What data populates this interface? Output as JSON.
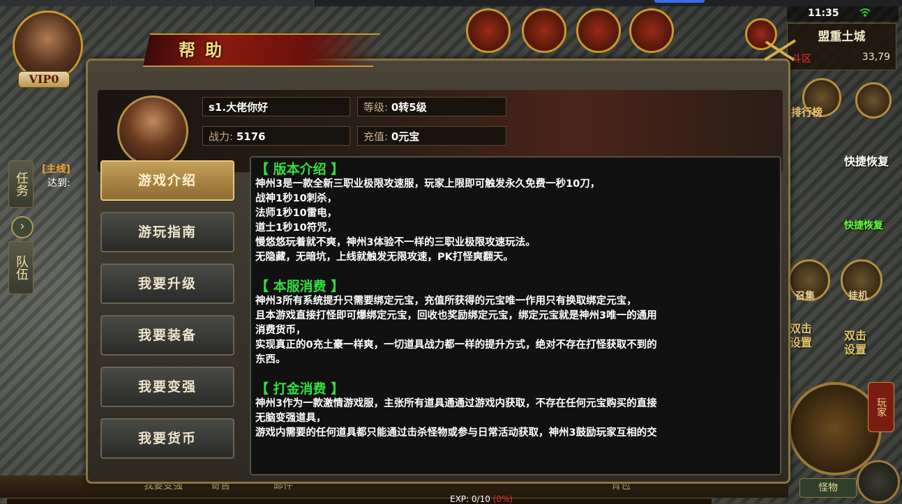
{
  "hud": {
    "clock": "11:35",
    "map_name": "盟重土城",
    "map_zone": "斗区",
    "map_coords": "33,79",
    "vip_badge": "VIP0",
    "quest_tab": "任务",
    "quest_type": "[主线]",
    "quest_goal": "达到:",
    "team_tab": "队伍",
    "ranking_label": "排行榜",
    "quick_restore": "快捷恢复",
    "quick_restore_2": "快捷恢复",
    "summon_label": "召集",
    "autohunt_label": "挂机",
    "double_click_left": "双击设置",
    "double_click_right": "双击设置",
    "play_tab": "玩家",
    "monster_button": "怪物",
    "bottom_items": [
      "我要变强",
      "寄售",
      "邮件",
      "背包"
    ],
    "exp_label": "EXP: 0/10",
    "exp_pct": "(0%)",
    "exp_fraction": 0
  },
  "dialog": {
    "title": "帮助",
    "player": {
      "name": "s1.大佬你好",
      "level_label": "等级:",
      "level_value": "0转5级",
      "power_label": "战力:",
      "power_value": "5176",
      "recharge_label": "充值:",
      "recharge_value": "0元宝"
    },
    "menu": [
      {
        "label": "游戏介绍",
        "active": true
      },
      {
        "label": "游玩指南",
        "active": false
      },
      {
        "label": "我要升级",
        "active": false
      },
      {
        "label": "我要装备",
        "active": false
      },
      {
        "label": "我要变强",
        "active": false
      },
      {
        "label": "我要货币",
        "active": false
      }
    ],
    "sections": [
      {
        "title": "【 版本介绍 】",
        "lines": [
          "神州3是一款全新三职业极限攻速服，玩家上限即可触发永久免费一秒10刀，",
          "战神1秒10刺杀，",
          "法师1秒10雷电，",
          "道士1秒10符咒，",
          "慢悠悠玩着就不爽，神州3体验不一样的三职业极限攻速玩法。",
          "无隐藏，无暗坑，上线就触发无限攻速，PK打怪爽翻天。"
        ]
      },
      {
        "title": "【 本服消费 】",
        "lines": [
          "神州3所有系统提升只需要绑定元宝，充值所获得的元宝唯一作用只有换取绑定元宝，",
          "且本游戏直接打怪即可爆绑定元宝，回收也奖励绑定元宝，绑定元宝就是神州3唯一的通用",
          "消费货币，",
          "实现真正的0充土豪一样爽，一切道具战力都一样的提升方式，绝对不存在打怪获取不到的",
          "东西。"
        ]
      },
      {
        "title": "【 打金消费 】",
        "lines": [
          "神州3作为一款激情游戏服，主张所有道具通通过游戏内获取，不存在任何元宝购买的直接",
          "无脑变强道具，",
          "游戏内需要的任何道具都只能通过击杀怪物或参与日常活动获取，神州3鼓励玩家互相的交"
        ]
      }
    ]
  }
}
